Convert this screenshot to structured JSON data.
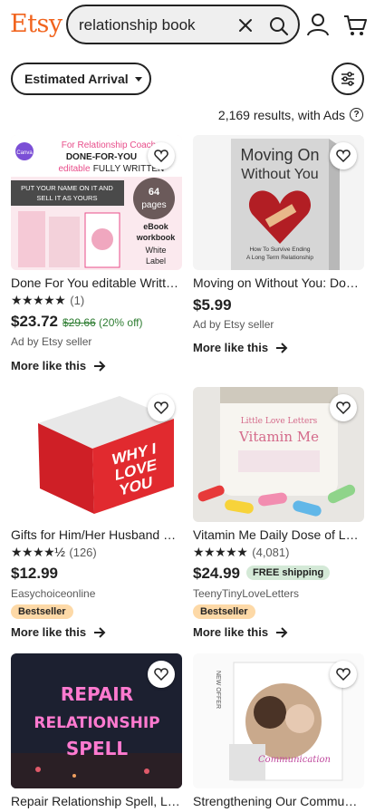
{
  "header": {
    "logo": "Etsy",
    "search_value": "relationship book",
    "clear_icon": "close-icon",
    "search_icon": "search-icon",
    "account_icon": "account-icon",
    "cart_icon": "cart-icon",
    "accent": "#f1641e"
  },
  "filters": {
    "sort_label": "Estimated Arrival",
    "filters_icon": "sliders-icon"
  },
  "results_text": "2,169 results, with Ads",
  "listings": [
    {
      "title": "Done For You editable Written eBook workbook",
      "stars": "★★★★★",
      "reviews": "(1)",
      "price": "$23.72",
      "original_price": "$29.66",
      "discount": "(20% off)",
      "seller": "Ad by Etsy seller",
      "more": "More like this",
      "image_text": {
        "line1": "For Relationship Coach",
        "line2": "DONE-FOR-YOU",
        "line3": "editable",
        "line4": "FULLY WRITTEN",
        "line5": "PUT YOUR NAME ON IT AND",
        "line6": "SELL IT AS YOURS",
        "badge_num": "64",
        "badge_word": "pages",
        "side1": "eBook",
        "side2": "workbook",
        "side3": "White",
        "side4": "Label",
        "canva": "Canva"
      }
    },
    {
      "title": "Moving on Without You: Dos and Don'ts",
      "price": "$5.99",
      "seller": "Ad by Etsy seller",
      "more": "More like this",
      "image_text": {
        "line1": "Moving On",
        "line2": "Without You",
        "line3": "How To Survive Ending",
        "line4": "A Long Term Relationship"
      }
    },
    {
      "title": "Gifts for Him/Her Husband Wife Book",
      "stars": "★★★★½",
      "reviews": "(126)",
      "price": "$12.99",
      "seller": "Easychoiceonline",
      "badge": "Bestseller",
      "more": "More like this",
      "image_text": {
        "line1": "WHY I",
        "line2": "LOVE",
        "line3": "YOU"
      }
    },
    {
      "title": "Vitamin Me Daily Dose of Love Letters",
      "stars": "★★★★★",
      "reviews": "(4,081)",
      "price": "$24.99",
      "free_shipping": "FREE shipping",
      "seller": "TeenyTinyLoveLetters",
      "badge": "Bestseller",
      "more": "More like this",
      "image_text": {
        "line1": "Little Love Letters",
        "line2": "Vitamin Me"
      }
    },
    {
      "title": "Repair Relationship Spell, Love Spell",
      "image_text": {
        "line1": "REPAIR",
        "line2": "RELATIONSHIP",
        "line3": "SPELL"
      }
    },
    {
      "title": "Strengthening Our Communication Book",
      "image_text": {
        "line1": "Communication",
        "line2": "NEW OFFER"
      }
    }
  ]
}
